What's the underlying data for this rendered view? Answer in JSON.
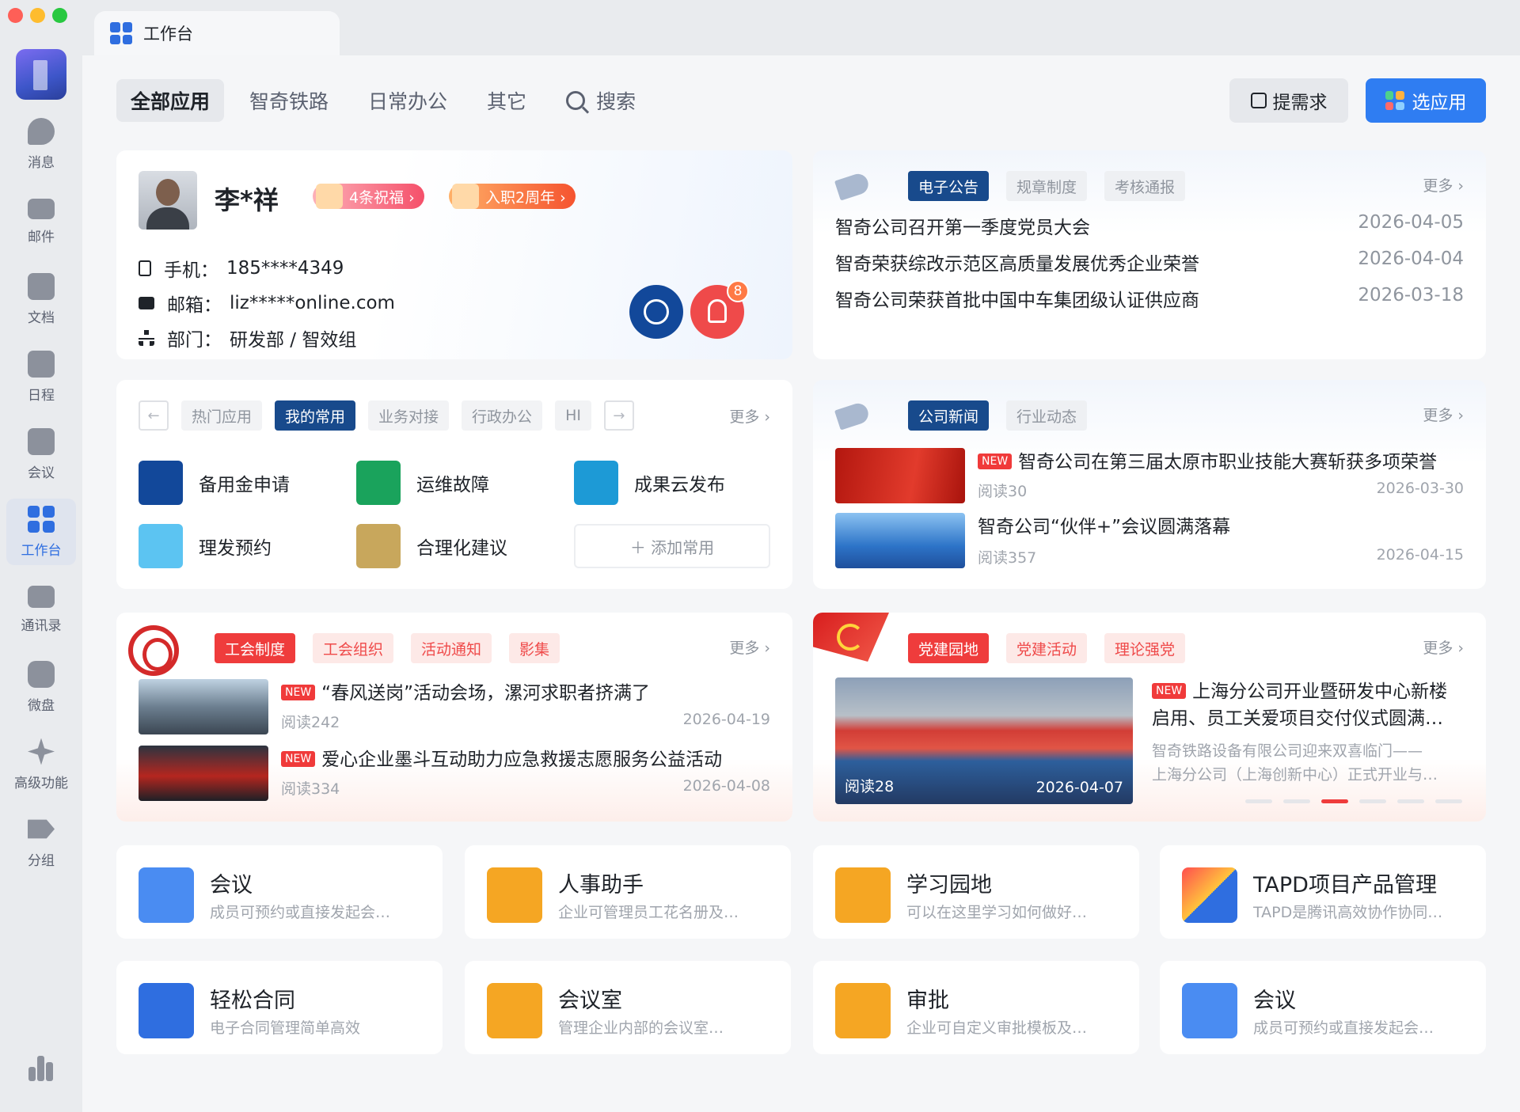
{
  "sidebar": {
    "items": [
      {
        "label": "消息",
        "icon": "chat-bubble-icon"
      },
      {
        "label": "邮件",
        "icon": "mail-icon"
      },
      {
        "label": "文档",
        "icon": "document-icon"
      },
      {
        "label": "日程",
        "icon": "calendar-icon"
      },
      {
        "label": "会议",
        "icon": "meeting-icon"
      },
      {
        "label": "工作台",
        "icon": "workbench-grid-icon",
        "active": true
      },
      {
        "label": "通讯录",
        "icon": "org-chart-icon"
      },
      {
        "label": "微盘",
        "icon": "cloud-drive-icon"
      },
      {
        "label": "高级功能",
        "icon": "sparkle-icon"
      },
      {
        "label": "分组",
        "icon": "tag-icon"
      }
    ]
  },
  "window": {
    "tab_title": "工作台"
  },
  "filters": {
    "tabs": [
      "全部应用",
      "智奇铁路",
      "日常办公",
      "其它"
    ],
    "search_label": "搜索",
    "request_button": "提需求",
    "select_button": "选应用"
  },
  "profile": {
    "name": "李*祥",
    "badge_wishes": "4条祝福 ›",
    "badge_anniversary": "入职2周年 ›",
    "phone_label": "手机：",
    "phone": "185****4349",
    "email_label": "邮箱：",
    "email": "liz*****online.com",
    "dept_label": "部门：",
    "dept": "研发部 / 智效组",
    "notification_count": "8"
  },
  "notice": {
    "tabs": [
      "电子公告",
      "规章制度",
      "考核通报"
    ],
    "more": "更多 ›",
    "items": [
      {
        "title": "智奇公司召开第一季度党员大会",
        "date": "2026-04-05"
      },
      {
        "title": "智奇荣获综改示范区高质量发展优秀企业荣誉",
        "date": "2026-04-04"
      },
      {
        "title": "智奇公司荣获首批中国中车集团级认证供应商",
        "date": "2026-03-18"
      }
    ]
  },
  "apps": {
    "prev": "←",
    "next": "→",
    "tabs": [
      "热门应用",
      "我的常用",
      "业务对接",
      "行政办公",
      "HI"
    ],
    "more": "更多 ›",
    "items": [
      "备用金申请",
      "运维故障",
      "成果云发布",
      "理发预约",
      "合理化建议"
    ],
    "add_label": "＋  添加常用"
  },
  "news": {
    "tabs": [
      "公司新闻",
      "行业动态"
    ],
    "more": "更多 ›",
    "new_tag": "NEW",
    "items": [
      {
        "title": "智奇公司在第三届太原市职业技能大赛斩获多项荣誉",
        "reads": "阅读30",
        "date": "2026-03-30"
      },
      {
        "title": "智奇公司“伙伴+”会议圆满落幕",
        "reads": "阅读357",
        "date": "2026-04-15"
      }
    ]
  },
  "union": {
    "tabs": [
      "工会制度",
      "工会组织",
      "活动通知",
      "影集"
    ],
    "more": "更多 ›",
    "new_tag": "NEW",
    "items": [
      {
        "title": "“春风送岗”活动会场，漯河求职者挤满了",
        "reads": "阅读242",
        "date": "2026-04-19"
      },
      {
        "title": "爱心企业墨斗互动助力应急救援志愿服务公益活动",
        "reads": "阅读334",
        "date": "2026-04-08"
      }
    ]
  },
  "party": {
    "tabs": [
      "党建园地",
      "党建活动",
      "理论强党"
    ],
    "more": "更多 ›",
    "new_tag": "NEW",
    "image_reads": "阅读28",
    "image_date": "2026-04-07",
    "title_line1": "上海分公司开业暨研发中心新楼",
    "title_line2": "启用、员工关爱项目交付仪式圆满…",
    "summary_line1": "智奇铁路设备有限公司迎来双喜临门——",
    "summary_line2": "上海分公司（上海创新中心）正式开业与…"
  },
  "tiles": [
    {
      "name": "会议",
      "desc": "成员可预约或直接发起会…",
      "icon": "meeting-icon",
      "color": "#4a8cf2"
    },
    {
      "name": "人事助手",
      "desc": "企业可管理员工花名册及…",
      "icon": "person-icon",
      "color": "#f5a623"
    },
    {
      "name": "学习园地",
      "desc": "可以在这里学习如何做好…",
      "icon": "planet-icon",
      "color": "#f5a623"
    },
    {
      "name": "TAPD项目产品管理",
      "desc": "TAPD是腾讯高效协作协同…",
      "icon": "tapd-logo-icon",
      "color": "#2f6ee0"
    },
    {
      "name": "轻松合同",
      "desc": "电子合同管理简单高效",
      "icon": "contract-icon",
      "color": "#2f6ee0"
    },
    {
      "name": "会议室",
      "desc": "管理企业内部的会议室…",
      "icon": "door-icon",
      "color": "#f5a623"
    },
    {
      "name": "审批",
      "desc": "企业可自定义审批模板及…",
      "icon": "stamp-icon",
      "color": "#f5a623"
    },
    {
      "name": "会议",
      "desc": "成员可预约或直接发起会…",
      "icon": "meeting-icon",
      "color": "#4a8cf2"
    }
  ]
}
